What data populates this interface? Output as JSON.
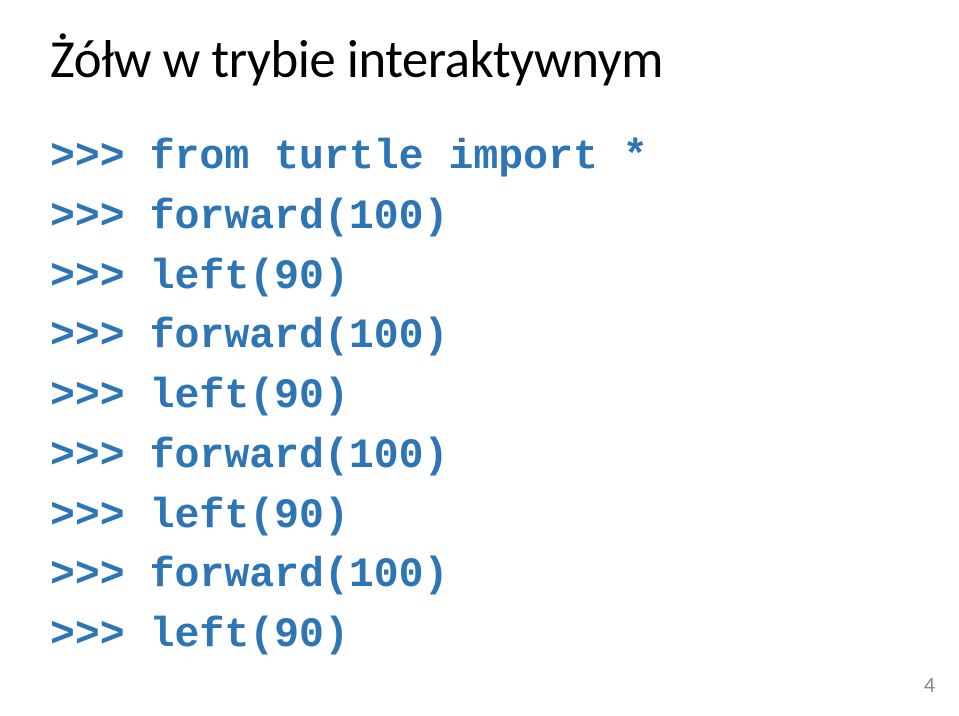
{
  "title": "Żółw w trybie interaktywnym",
  "code": {
    "l0": ">>> from turtle import *",
    "l1": ">>> forward(100)",
    "l2": ">>> left(90)",
    "l3": ">>> forward(100)",
    "l4": ">>> left(90)",
    "l5": ">>> forward(100)",
    "l6": ">>> left(90)",
    "l7": ">>> forward(100)",
    "l8": ">>> left(90)"
  },
  "page_number": "4"
}
